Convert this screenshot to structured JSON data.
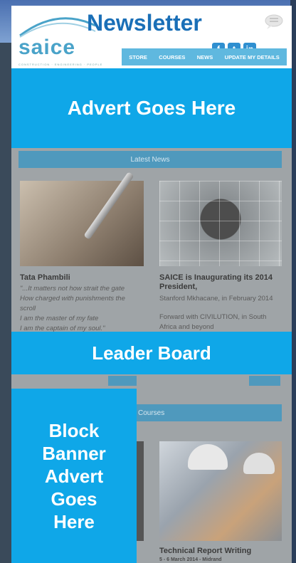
{
  "header": {
    "logo_text": "saice",
    "logo_tagline": "CONSTRUCTION · ENGINEERING · PEOPLE",
    "newsletter_title": "Newsletter",
    "social": [
      "f",
      "t",
      "in"
    ],
    "nav": [
      "STORE",
      "COURSES",
      "NEWS",
      "UPDATE MY DETAILS"
    ]
  },
  "ads": {
    "top": "Advert Goes Here",
    "leader": "Leader Board",
    "block": "Block Banner Advert Goes Here"
  },
  "news": {
    "section_title": "Latest News",
    "item1": {
      "title": "Tata Phambili",
      "lines": [
        "\"...It matters not how strait the gate",
        "How charged with punishments the",
        "scroll",
        "I am the master of my fate",
        "I am the captain of my soul.\""
      ]
    },
    "item2": {
      "title": "SAICE is Inaugurating its 2014 President,",
      "lines": [
        "Stanford Mkhacane, in February 2014",
        "Forward with CIVILUTION, in South",
        "Africa and beyond"
      ]
    }
  },
  "courses": {
    "section_title": "Courses",
    "item_title": "Technical Report Writing",
    "item_date": "5 - 6 March 2014 - Midrand"
  },
  "colors": {
    "advert_blue": "#0fa7e8",
    "nav_blue": "#5fb8df",
    "title_blue": "#1a6fb7"
  }
}
